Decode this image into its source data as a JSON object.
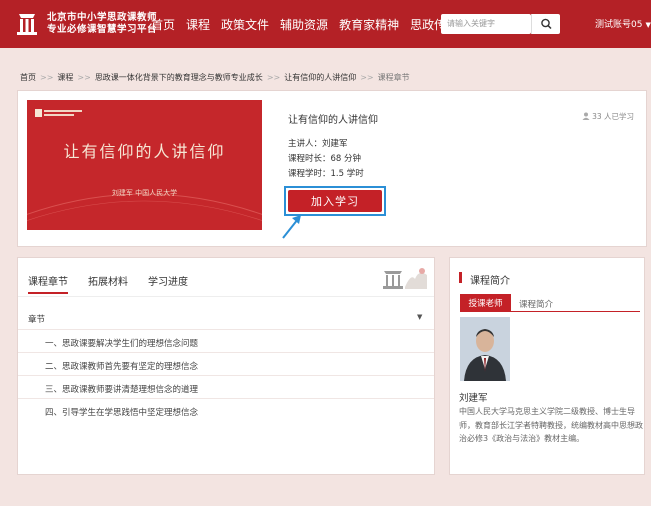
{
  "header": {
    "brand_line1": "北京市中小学思政课教师",
    "brand_line2": "专业必修课智慧学习平台",
    "nav": [
      "首页",
      "课程",
      "政策文件",
      "辅助资源",
      "教育家精神",
      "思政传习坊"
    ],
    "search_placeholder": "请输入关键字",
    "account": "测试账号05"
  },
  "breadcrumb": {
    "items": [
      "首页",
      "课程",
      "思政课一体化背景下的教育理念与教师专业成长",
      "让有信仰的人讲信仰"
    ],
    "current": "课程章节",
    "separator": ">>"
  },
  "course": {
    "cover_title": "让有信仰的人讲信仰",
    "cover_subtitle": "刘建军  中国人民大学",
    "title": "让有信仰的人讲信仰",
    "learners": "33 人已学习",
    "lecturer": "主讲人：刘建军",
    "duration": "课程时长：68 分钟",
    "hours": "课程学时：1.5 学时",
    "join_label": "加入学习"
  },
  "chapters": {
    "tabs": [
      "课程章节",
      "拓展材料",
      "学习进度"
    ],
    "active_tab": 0,
    "section_label": "章节",
    "items": [
      "一、思政课要解决学生们的理想信念问题",
      "二、思政课教师首先要有坚定的理想信念",
      "三、思政课教师要讲清楚理想信念的道理",
      "四、引导学生在学思践悟中坚定理想信念"
    ]
  },
  "intro": {
    "title": "课程简介",
    "tabs": [
      "授课老师",
      "课程简介"
    ],
    "teacher_name": "刘建军",
    "teacher_bio": "中国人民大学马克思主义学院二级教授、博士生导师，教育部长江学者特聘教授，统编教材高中思想政治必修3《政治与法治》教材主编。"
  },
  "colors": {
    "primary": "#b42126",
    "button": "#c42127",
    "highlight": "#2b8fd6",
    "background": "#f3e4e1"
  }
}
